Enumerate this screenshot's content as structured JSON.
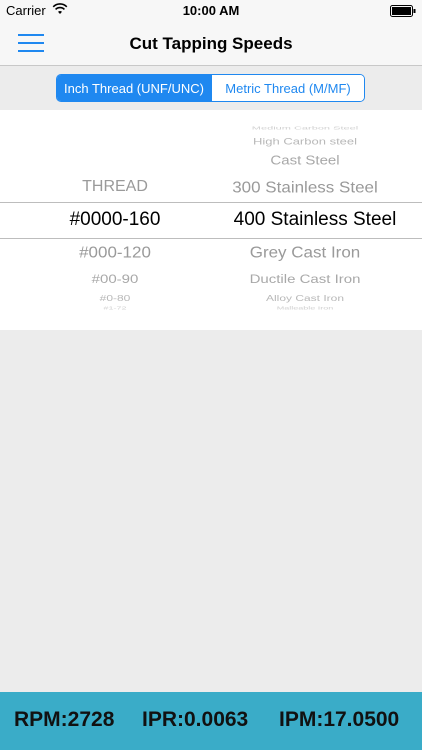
{
  "status_bar": {
    "carrier": "Carrier",
    "time": "10:00 AM"
  },
  "nav": {
    "title": "Cut Tapping Speeds"
  },
  "segments": {
    "inch": "Inch Thread (UNF/UNC)",
    "metric": "Metric Thread (M/MF)"
  },
  "picker": {
    "thread_label": "THREAD",
    "threads": [
      "#0000-160",
      "#000-120",
      "#00-90",
      "#0-80",
      "#1-72"
    ],
    "materials": [
      "Medium Carbon Steel",
      "High Carbon steel",
      "Cast Steel",
      "300 Stainless Steel",
      "400 Stainless Steel",
      "Grey Cast Iron",
      "Ductile Cast Iron",
      "Alloy Cast Iron",
      "Malleable Iron"
    ]
  },
  "results": {
    "rpm": "RPM:2728",
    "ipr": "IPR:0.0063",
    "ipm": "IPM:17.0500"
  },
  "colors": {
    "accent": "#1f88f0",
    "bottom_bar": "#3aacc8"
  }
}
